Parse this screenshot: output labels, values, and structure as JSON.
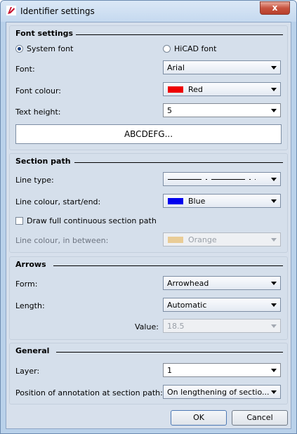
{
  "window": {
    "title": "Identifier settings",
    "close_glyph": "x"
  },
  "font_settings": {
    "heading": "Font settings",
    "system_font_label": "System font",
    "hicad_font_label": "HiCAD font",
    "font_label": "Font:",
    "font_value": "Arial",
    "font_colour_label": "Font colour:",
    "font_colour_value": "Red",
    "font_colour_swatch": "#ee0000",
    "text_height_label": "Text height:",
    "text_height_value": "5",
    "preview_text": "ABCDEFG..."
  },
  "section_path": {
    "heading": "Section path",
    "line_type_label": "Line type:",
    "line_colour_label": "Line colour, start/end:",
    "line_colour_value": "Blue",
    "line_colour_swatch": "#0000ee",
    "full_path_label": "Draw full continuous section path",
    "between_label": "Line colour, in between:",
    "between_value": "Orange",
    "between_swatch": "#e9cc96"
  },
  "arrows": {
    "heading": "Arrows",
    "form_label": "Form:",
    "form_value": "Arrowhead",
    "length_label": "Length:",
    "length_value": "Automatic",
    "value_label": "Value:",
    "value_value": "18.5"
  },
  "general": {
    "heading": "General",
    "layer_label": "Layer:",
    "layer_value": "1",
    "position_label": "Position of annotation at section path:",
    "position_value": "On lengthening of sectio..."
  },
  "buttons": {
    "ok": "OK",
    "cancel": "Cancel"
  },
  "icons": {
    "app": "hicad-logo-icon",
    "close": "close-icon",
    "dropdown": "chevron-down-icon"
  }
}
